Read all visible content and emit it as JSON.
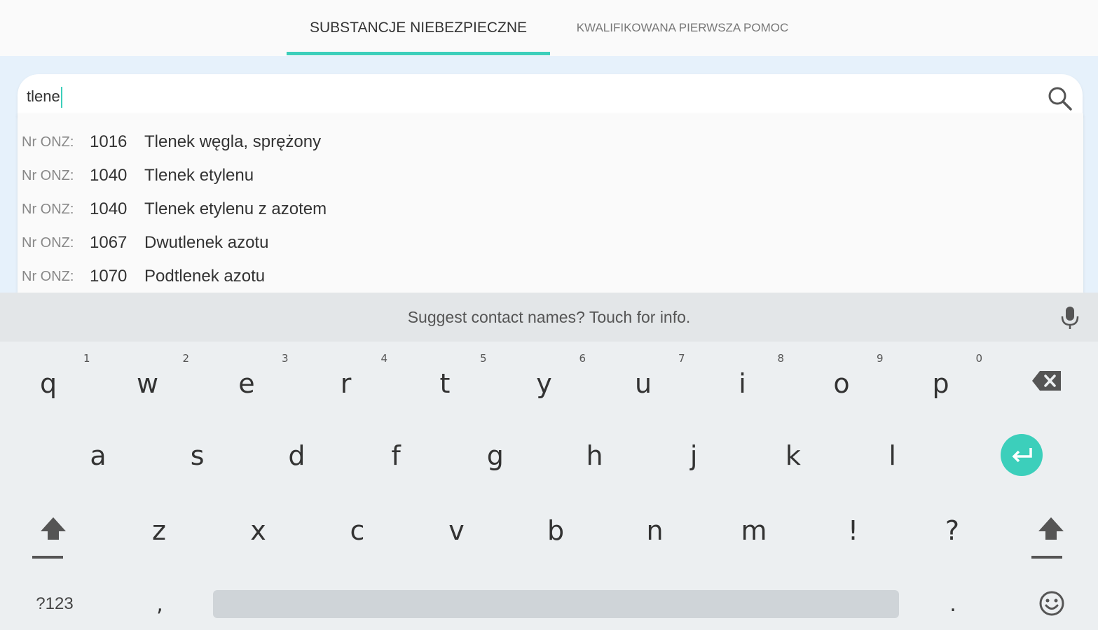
{
  "tabs": [
    {
      "label": "SUBSTANCJE NIEBEZPIECZNE",
      "active": true
    },
    {
      "label": "KWALIFIKOWANA PIERWSZA POMOC",
      "active": false
    }
  ],
  "search": {
    "value": "tlene"
  },
  "suggestions": [
    {
      "label": "Nr ONZ:",
      "number": "1016",
      "name": "Tlenek węgla, sprężony"
    },
    {
      "label": "Nr ONZ:",
      "number": "1040",
      "name": "Tlenek etylenu"
    },
    {
      "label": "Nr ONZ:",
      "number": "1040",
      "name": "Tlenek etylenu z azotem"
    },
    {
      "label": "Nr ONZ:",
      "number": "1067",
      "name": "Dwutlenek azotu"
    },
    {
      "label": "Nr ONZ:",
      "number": "1070",
      "name": "Podtlenek azotu"
    }
  ],
  "keyboard": {
    "suggestion_text": "Suggest contact names? Touch for info.",
    "row1": [
      "q",
      "w",
      "e",
      "r",
      "t",
      "y",
      "u",
      "i",
      "o",
      "p"
    ],
    "row1_hints": [
      "1",
      "2",
      "3",
      "4",
      "5",
      "6",
      "7",
      "8",
      "9",
      "0"
    ],
    "row2": [
      "a",
      "s",
      "d",
      "f",
      "g",
      "h",
      "j",
      "k",
      "l"
    ],
    "row3": [
      "z",
      "x",
      "c",
      "v",
      "b",
      "n",
      "m",
      "!",
      "?"
    ],
    "symbols_label": "?123",
    "comma": ",",
    "period": "."
  },
  "colors": {
    "accent": "#3ccfbb",
    "search_bg": "#e6f1fb",
    "keyboard_bg": "#eceff1"
  }
}
